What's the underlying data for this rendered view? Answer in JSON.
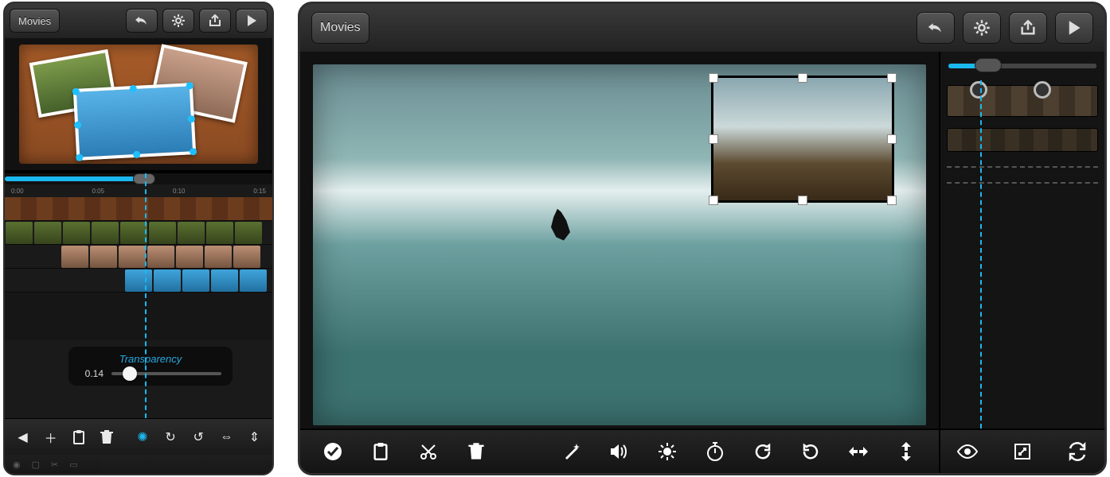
{
  "phone": {
    "back_label": "Movies",
    "ruler": [
      "0:00",
      "0:05",
      "0:10",
      "0:15"
    ],
    "transparency": {
      "title": "Transparency",
      "value": "0.14",
      "percent": 14
    },
    "toolbar_icons": [
      "undo",
      "settings",
      "share",
      "play"
    ],
    "bottom_icons": [
      "back",
      "add",
      "clipboard",
      "trash",
      "brightness",
      "redo",
      "undo2",
      "hflip",
      "vflip"
    ]
  },
  "tablet": {
    "back_label": "Movies",
    "toolbar_icons": [
      "undo",
      "settings",
      "share",
      "play"
    ],
    "bottom_icons": [
      "confirm",
      "clipboard",
      "cut",
      "trash",
      "wand",
      "volume",
      "brightness",
      "timer",
      "redo",
      "undo",
      "hflip",
      "vflip"
    ],
    "side_bottom_icons": [
      "visibility",
      "fullscreen",
      "sync"
    ]
  }
}
